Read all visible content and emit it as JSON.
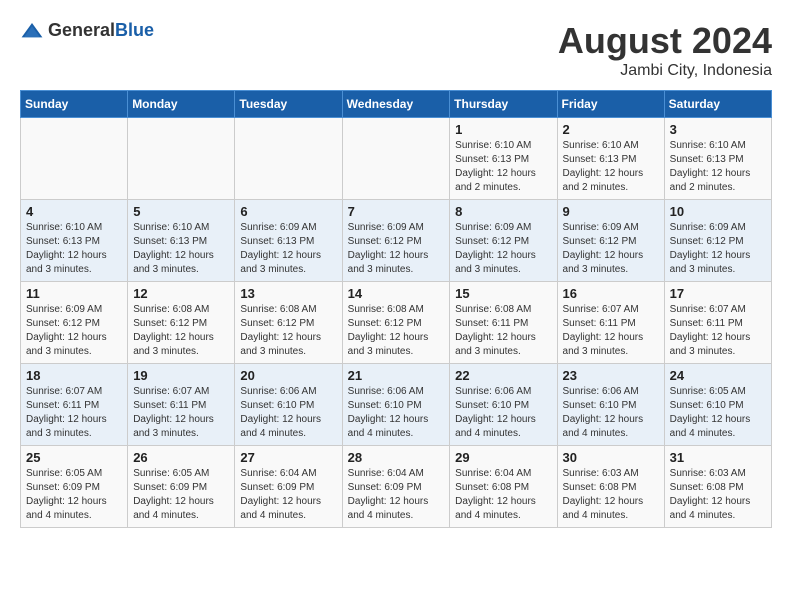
{
  "header": {
    "logo_general": "General",
    "logo_blue": "Blue",
    "main_title": "August 2024",
    "subtitle": "Jambi City, Indonesia"
  },
  "calendar": {
    "weekdays": [
      "Sunday",
      "Monday",
      "Tuesday",
      "Wednesday",
      "Thursday",
      "Friday",
      "Saturday"
    ],
    "weeks": [
      [
        {
          "day": "",
          "info": ""
        },
        {
          "day": "",
          "info": ""
        },
        {
          "day": "",
          "info": ""
        },
        {
          "day": "",
          "info": ""
        },
        {
          "day": "1",
          "info": "Sunrise: 6:10 AM\nSunset: 6:13 PM\nDaylight: 12 hours and 2 minutes."
        },
        {
          "day": "2",
          "info": "Sunrise: 6:10 AM\nSunset: 6:13 PM\nDaylight: 12 hours and 2 minutes."
        },
        {
          "day": "3",
          "info": "Sunrise: 6:10 AM\nSunset: 6:13 PM\nDaylight: 12 hours and 2 minutes."
        }
      ],
      [
        {
          "day": "4",
          "info": "Sunrise: 6:10 AM\nSunset: 6:13 PM\nDaylight: 12 hours and 3 minutes."
        },
        {
          "day": "5",
          "info": "Sunrise: 6:10 AM\nSunset: 6:13 PM\nDaylight: 12 hours and 3 minutes."
        },
        {
          "day": "6",
          "info": "Sunrise: 6:09 AM\nSunset: 6:13 PM\nDaylight: 12 hours and 3 minutes."
        },
        {
          "day": "7",
          "info": "Sunrise: 6:09 AM\nSunset: 6:12 PM\nDaylight: 12 hours and 3 minutes."
        },
        {
          "day": "8",
          "info": "Sunrise: 6:09 AM\nSunset: 6:12 PM\nDaylight: 12 hours and 3 minutes."
        },
        {
          "day": "9",
          "info": "Sunrise: 6:09 AM\nSunset: 6:12 PM\nDaylight: 12 hours and 3 minutes."
        },
        {
          "day": "10",
          "info": "Sunrise: 6:09 AM\nSunset: 6:12 PM\nDaylight: 12 hours and 3 minutes."
        }
      ],
      [
        {
          "day": "11",
          "info": "Sunrise: 6:09 AM\nSunset: 6:12 PM\nDaylight: 12 hours and 3 minutes."
        },
        {
          "day": "12",
          "info": "Sunrise: 6:08 AM\nSunset: 6:12 PM\nDaylight: 12 hours and 3 minutes."
        },
        {
          "day": "13",
          "info": "Sunrise: 6:08 AM\nSunset: 6:12 PM\nDaylight: 12 hours and 3 minutes."
        },
        {
          "day": "14",
          "info": "Sunrise: 6:08 AM\nSunset: 6:12 PM\nDaylight: 12 hours and 3 minutes."
        },
        {
          "day": "15",
          "info": "Sunrise: 6:08 AM\nSunset: 6:11 PM\nDaylight: 12 hours and 3 minutes."
        },
        {
          "day": "16",
          "info": "Sunrise: 6:07 AM\nSunset: 6:11 PM\nDaylight: 12 hours and 3 minutes."
        },
        {
          "day": "17",
          "info": "Sunrise: 6:07 AM\nSunset: 6:11 PM\nDaylight: 12 hours and 3 minutes."
        }
      ],
      [
        {
          "day": "18",
          "info": "Sunrise: 6:07 AM\nSunset: 6:11 PM\nDaylight: 12 hours and 3 minutes."
        },
        {
          "day": "19",
          "info": "Sunrise: 6:07 AM\nSunset: 6:11 PM\nDaylight: 12 hours and 3 minutes."
        },
        {
          "day": "20",
          "info": "Sunrise: 6:06 AM\nSunset: 6:10 PM\nDaylight: 12 hours and 4 minutes."
        },
        {
          "day": "21",
          "info": "Sunrise: 6:06 AM\nSunset: 6:10 PM\nDaylight: 12 hours and 4 minutes."
        },
        {
          "day": "22",
          "info": "Sunrise: 6:06 AM\nSunset: 6:10 PM\nDaylight: 12 hours and 4 minutes."
        },
        {
          "day": "23",
          "info": "Sunrise: 6:06 AM\nSunset: 6:10 PM\nDaylight: 12 hours and 4 minutes."
        },
        {
          "day": "24",
          "info": "Sunrise: 6:05 AM\nSunset: 6:10 PM\nDaylight: 12 hours and 4 minutes."
        }
      ],
      [
        {
          "day": "25",
          "info": "Sunrise: 6:05 AM\nSunset: 6:09 PM\nDaylight: 12 hours and 4 minutes."
        },
        {
          "day": "26",
          "info": "Sunrise: 6:05 AM\nSunset: 6:09 PM\nDaylight: 12 hours and 4 minutes."
        },
        {
          "day": "27",
          "info": "Sunrise: 6:04 AM\nSunset: 6:09 PM\nDaylight: 12 hours and 4 minutes."
        },
        {
          "day": "28",
          "info": "Sunrise: 6:04 AM\nSunset: 6:09 PM\nDaylight: 12 hours and 4 minutes."
        },
        {
          "day": "29",
          "info": "Sunrise: 6:04 AM\nSunset: 6:08 PM\nDaylight: 12 hours and 4 minutes."
        },
        {
          "day": "30",
          "info": "Sunrise: 6:03 AM\nSunset: 6:08 PM\nDaylight: 12 hours and 4 minutes."
        },
        {
          "day": "31",
          "info": "Sunrise: 6:03 AM\nSunset: 6:08 PM\nDaylight: 12 hours and 4 minutes."
        }
      ]
    ]
  }
}
